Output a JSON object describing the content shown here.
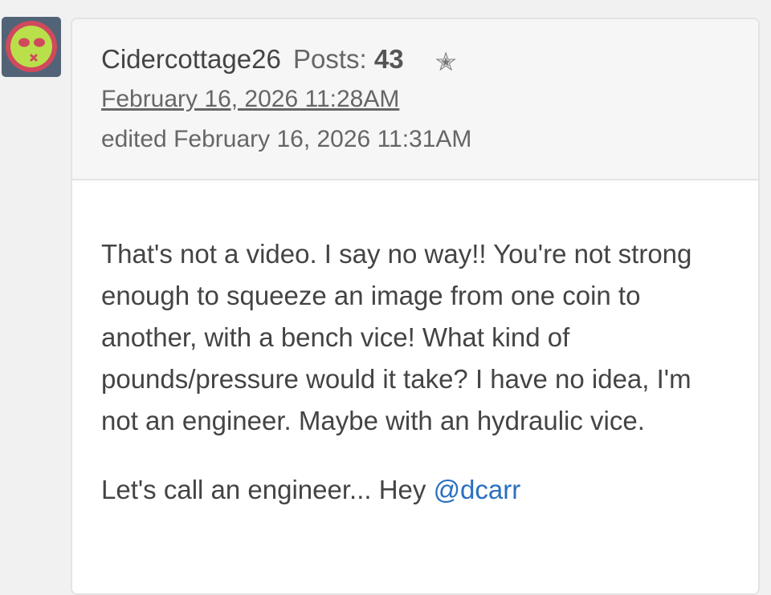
{
  "avatar": {
    "icon": "sick-face-icon",
    "bg_color": "#536377",
    "face_color": "#b9e04a",
    "accent_color": "#d0495d"
  },
  "post": {
    "author": "Cidercottage26",
    "posts_label": "Posts:",
    "posts_count": "43",
    "rank_icon": "star-icon",
    "date": "February 16, 2026 11:28AM",
    "edited": "edited February 16, 2026 11:31AM",
    "body": {
      "paragraph1": "That's not a video. I say no way!! You're not strong enough to squeeze an image from one coin to another, with a bench vice! What kind of pounds/pressure would it take? I have no idea, I'm not an engineer. Maybe with an hydraulic vice.",
      "paragraph2_text": "Let's call an engineer... Hey ",
      "mention": "@dcarr"
    }
  },
  "colors": {
    "mention": "#2a70c0",
    "header_bg": "#f6f6f6",
    "page_bg": "#f1f1f1"
  }
}
